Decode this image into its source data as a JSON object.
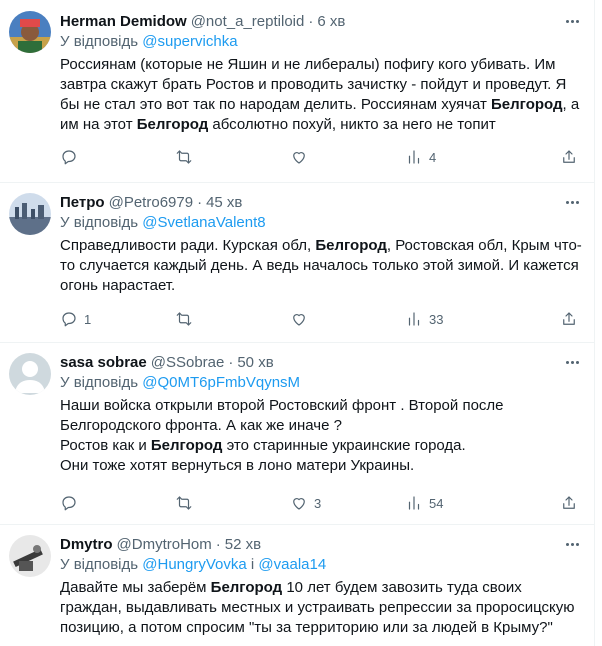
{
  "labels": {
    "reply_prefix": "У відповідь",
    "and": "і"
  },
  "tweets": [
    {
      "name": "Herman Demidow",
      "handle": "@not_a_reptiloid",
      "time": "6 хв",
      "reply_to": "@supervichka",
      "lines": [
        [
          {
            "t": "Россиянам (которые не Яшин и не либералы) пофигу кого убивать. Им",
            "b": false
          }
        ],
        [
          {
            "t": "завтра скажут брать Ростов и проводить зачистку - пойдут и проведут. Я",
            "b": false
          }
        ],
        [
          {
            "t": "бы не стал это вот так по народам делить. Россиянам хуячат ",
            "b": false
          },
          {
            "t": "Белгород",
            "b": true
          },
          {
            "t": ", а",
            "b": false
          }
        ],
        [
          {
            "t": "им на этот ",
            "b": false
          },
          {
            "t": "Белгород",
            "b": true
          },
          {
            "t": " абсолютно похуй, никто за него не топит",
            "b": false
          }
        ]
      ],
      "stats": {
        "replies": "",
        "retweets": "",
        "likes": "",
        "views": "4"
      }
    },
    {
      "name": "Петро",
      "handle": "@Petro6979",
      "time": "45 хв",
      "reply_to": "@SvetlanaValent8",
      "lines": [
        [
          {
            "t": "Справедливости ради. Курская обл, ",
            "b": false
          },
          {
            "t": "Белгород",
            "b": true
          },
          {
            "t": ", Ростовская обл, Крым что-",
            "b": false
          }
        ],
        [
          {
            "t": "то случается каждый день. А ведь началось только этой зимой. И кажется",
            "b": false
          }
        ],
        [
          {
            "t": "огонь нарастает.",
            "b": false
          }
        ]
      ],
      "stats": {
        "replies": "1",
        "retweets": "",
        "likes": "",
        "views": "33"
      }
    },
    {
      "name": "sasa sobrae",
      "handle": "@SSobrae",
      "time": "50 хв",
      "reply_to": "@Q0MT6pFmbVqynsM",
      "lines": [
        [
          {
            "t": "Наши войска открыли второй Ростовский фронт . Второй после",
            "b": false
          }
        ],
        [
          {
            "t": "Белгородского фронта. А как же иначе ?",
            "b": false
          }
        ],
        [
          {
            "t": "Ростов как и ",
            "b": false
          },
          {
            "t": "Белгород",
            "b": true
          },
          {
            "t": " это старинные украинские города.",
            "b": false
          }
        ],
        [
          {
            "t": "Они тоже хотят вернуться в лоно матери Украины.",
            "b": false
          }
        ]
      ],
      "stats": {
        "replies": "",
        "retweets": "",
        "likes": "3",
        "views": "54"
      }
    },
    {
      "name": "Dmytro",
      "handle": "@DmytroHom",
      "time": "52 хв",
      "reply_to": "@HungryVovka",
      "reply_to_2": "@vaala14",
      "lines": [
        [
          {
            "t": "Давайте мы заберём ",
            "b": false
          },
          {
            "t": "Белгород",
            "b": true
          },
          {
            "t": " 10 лет будем завозить туда своих",
            "b": false
          }
        ],
        [
          {
            "t": "граждан, выдавливать местных и устраивать репрессии за проросицскую",
            "b": false
          }
        ],
        [
          {
            "t": "позицию, а потом спросим \"ты за территорию или за людей в Крыму?\"",
            "b": false
          }
        ]
      ],
      "stats": {
        "replies": "",
        "retweets": "",
        "likes": "",
        "views": ""
      }
    }
  ]
}
